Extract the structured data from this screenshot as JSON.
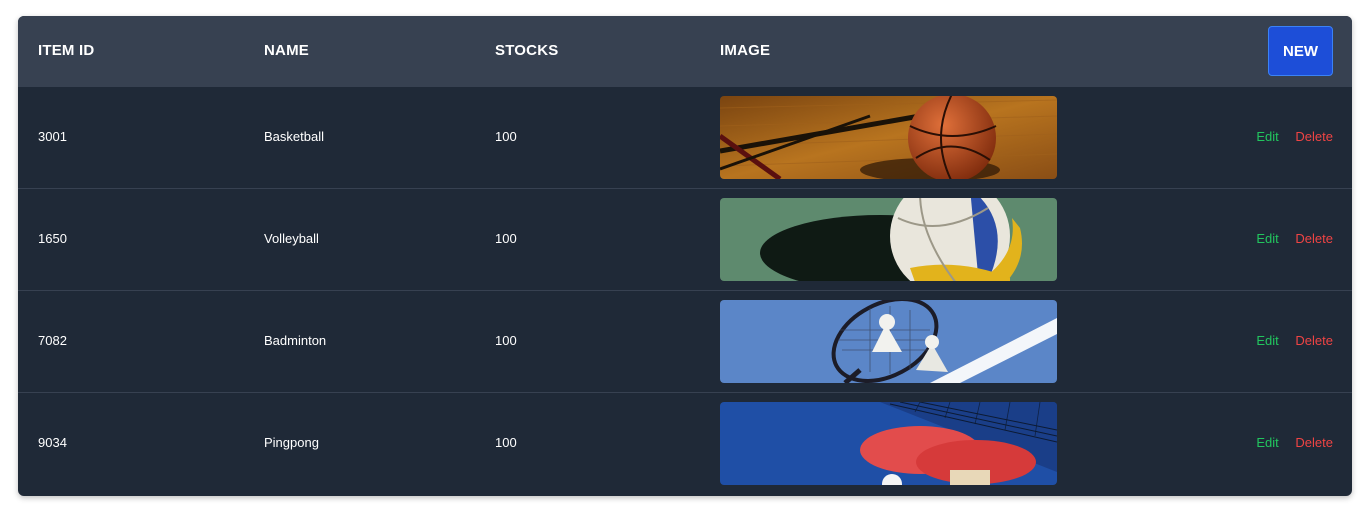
{
  "table": {
    "headers": {
      "item_id": "ITEM ID",
      "name": "NAME",
      "stocks": "STOCKS",
      "image": "IMAGE"
    },
    "new_label": "NEW",
    "rows": [
      {
        "item_id": "3001",
        "name": "Basketball",
        "stocks": "100",
        "image": "basketball-photo",
        "edit_label": "Edit",
        "delete_label": "Delete"
      },
      {
        "item_id": "1650",
        "name": "Volleyball",
        "stocks": "100",
        "image": "volleyball-photo",
        "edit_label": "Edit",
        "delete_label": "Delete"
      },
      {
        "item_id": "7082",
        "name": "Badminton",
        "stocks": "100",
        "image": "badminton-photo",
        "edit_label": "Edit",
        "delete_label": "Delete"
      },
      {
        "item_id": "9034",
        "name": "Pingpong",
        "stocks": "100",
        "image": "pingpong-photo",
        "edit_label": "Edit",
        "delete_label": "Delete"
      }
    ]
  },
  "colors": {
    "header_bg": "#374151",
    "body_bg": "#1f2937",
    "new_button": "#1d4ed8",
    "edit": "#22c55e",
    "delete": "#ef4444"
  }
}
